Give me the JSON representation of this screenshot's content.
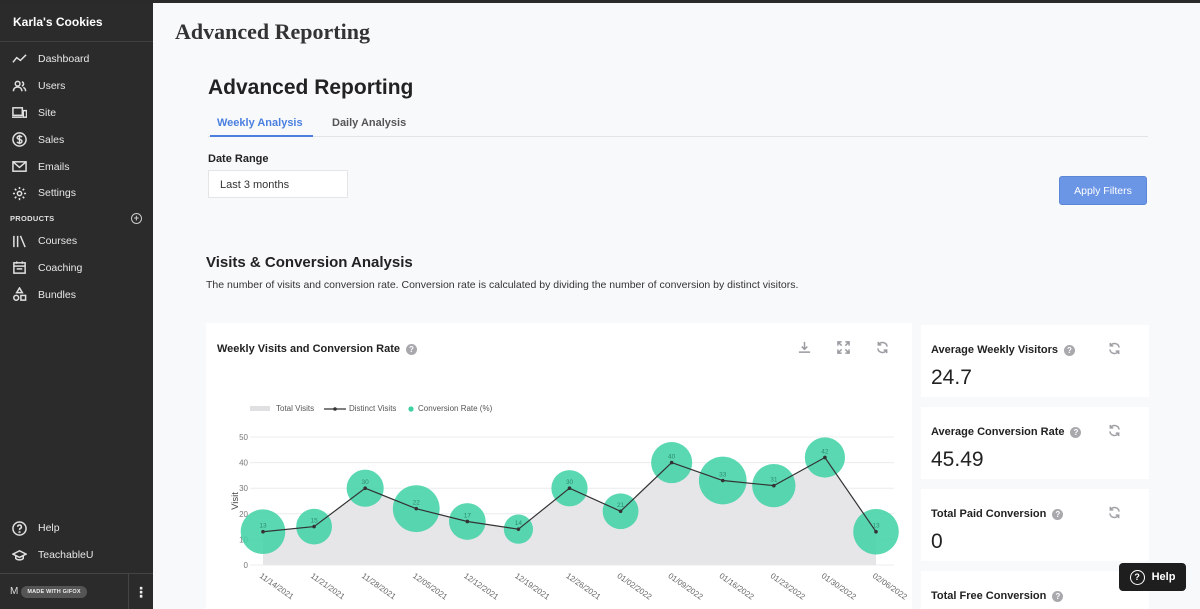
{
  "sidebar": {
    "brand": "Karla's Cookies",
    "items": [
      {
        "label": "Dashboard",
        "icon": "trend-icon"
      },
      {
        "label": "Users",
        "icon": "users-icon"
      },
      {
        "label": "Site",
        "icon": "devices-icon"
      },
      {
        "label": "Sales",
        "icon": "dollar-icon"
      },
      {
        "label": "Emails",
        "icon": "mail-icon"
      },
      {
        "label": "Settings",
        "icon": "gear-icon"
      }
    ],
    "products_heading": "PRODUCTS",
    "product_items": [
      {
        "label": "Courses",
        "icon": "library-icon"
      },
      {
        "label": "Coaching",
        "icon": "calendar-icon"
      },
      {
        "label": "Bundles",
        "icon": "shapes-icon"
      }
    ],
    "bottom_items": [
      {
        "label": "Help",
        "icon": "help-icon"
      },
      {
        "label": "TeachableU",
        "icon": "graduation-cap-icon"
      }
    ],
    "footer_initial": "M",
    "gifox_badge": "MADE WITH GIFOX"
  },
  "main": {
    "page_title": "Advanced Reporting",
    "section_title": "Advanced Reporting",
    "tabs": [
      {
        "label": "Weekly Analysis",
        "active": true
      },
      {
        "label": "Daily Analysis",
        "active": false
      }
    ],
    "date_range_label": "Date Range",
    "date_range_value": "Last 3 months",
    "apply_button": "Apply Filters",
    "visits_title": "Visits & Conversion Analysis",
    "visits_desc": "The number of visits and conversion rate. Conversion rate is calculated by dividing the number of conversion by distinct visitors."
  },
  "chart_card": {
    "title": "Weekly Visits and Conversion Rate",
    "help_glyph": "?"
  },
  "stats": [
    {
      "label": "Average Weekly Visitors",
      "value": "24.7"
    },
    {
      "label": "Average Conversion Rate",
      "value": "45.49"
    },
    {
      "label": "Total Paid Conversion",
      "value": "0"
    },
    {
      "label": "Total Free Conversion",
      "value": ""
    }
  ],
  "help_button": "Help",
  "colors": {
    "accent": "#4a7fe0",
    "bubble": "#3dd1a3",
    "sidebar_bg": "#2b2b2b",
    "area_fill": "#e6e6e8"
  },
  "chart_data": {
    "type": "line",
    "x": [
      "11/14/2021",
      "11/21/2021",
      "11/28/2021",
      "12/05/2021",
      "12/12/2021",
      "12/19/2021",
      "12/26/2021",
      "01/02/2022",
      "01/09/2022",
      "01/16/2022",
      "01/23/2022",
      "01/30/2022",
      "02/06/2022"
    ],
    "ylabel": "Visit",
    "ylim": [
      0,
      50
    ],
    "yticks": [
      0,
      10,
      20,
      30,
      40,
      50
    ],
    "legend": [
      "Total Visits",
      "Distinct Visits",
      "Conversion Rate (%)"
    ],
    "legend_placement": "top-left",
    "series": [
      {
        "name": "Total Visits",
        "type": "area",
        "values": [
          13,
          15,
          30,
          22,
          17,
          14,
          30,
          21,
          40,
          33,
          31,
          42,
          13
        ]
      },
      {
        "name": "Distinct Visits",
        "type": "line",
        "values": [
          13,
          15,
          30,
          22,
          17,
          14,
          30,
          21,
          40,
          33,
          31,
          42,
          13
        ]
      },
      {
        "name": "Conversion Rate (%)",
        "type": "bubble",
        "values": [
          65,
          45,
          48,
          70,
          47,
          30,
          46,
          45,
          57,
          72,
          62,
          55,
          67
        ],
        "labels": [
          "13",
          "15",
          "30",
          "22",
          "17",
          "14",
          "30",
          "21",
          "40",
          "33",
          "31",
          "42",
          "13"
        ]
      }
    ],
    "grid": true
  }
}
